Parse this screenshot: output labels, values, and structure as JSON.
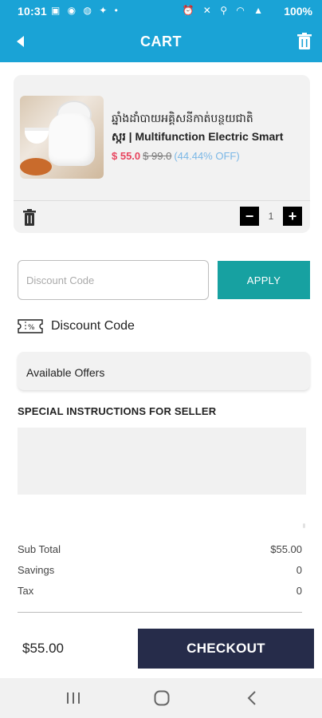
{
  "status_bar": {
    "time": "10:31",
    "battery": "100%"
  },
  "app_bar": {
    "title": "CART",
    "back_icon": "back-arrow-icon",
    "clear_icon": "trash-icon"
  },
  "cart_item": {
    "name_khmer": "ឆ្នាំងដាំបាយអគ្គិសនីកាត់បន្ថយជាតិ",
    "name_english": "ស្ករ | Multifunction Electric Smart",
    "price": "$ 55.0",
    "original_price": "$ 99.0",
    "discount": "(44.44% OFF)",
    "quantity": "1",
    "minus_label": "−",
    "plus_label": "+"
  },
  "discount": {
    "placeholder": "Discount Code",
    "apply_label": "APPLY",
    "code_label": "Discount Code"
  },
  "offers": {
    "label": "Available Offers"
  },
  "instructions": {
    "label": "SPECIAL INSTRUCTIONS FOR SELLER"
  },
  "totals": {
    "rows": [
      {
        "label": "Sub Total",
        "value": "$55.00"
      },
      {
        "label": "Savings",
        "value": "0"
      },
      {
        "label": "Tax",
        "value": "0"
      }
    ]
  },
  "checkout_bar": {
    "total": "$55.00",
    "button_label": "CHECKOUT"
  },
  "colors": {
    "primary": "#1aa3d6",
    "apply": "#17a1a1",
    "checkout": "#262c4a",
    "price": "#e8445e",
    "discount": "#7ab7e6"
  }
}
